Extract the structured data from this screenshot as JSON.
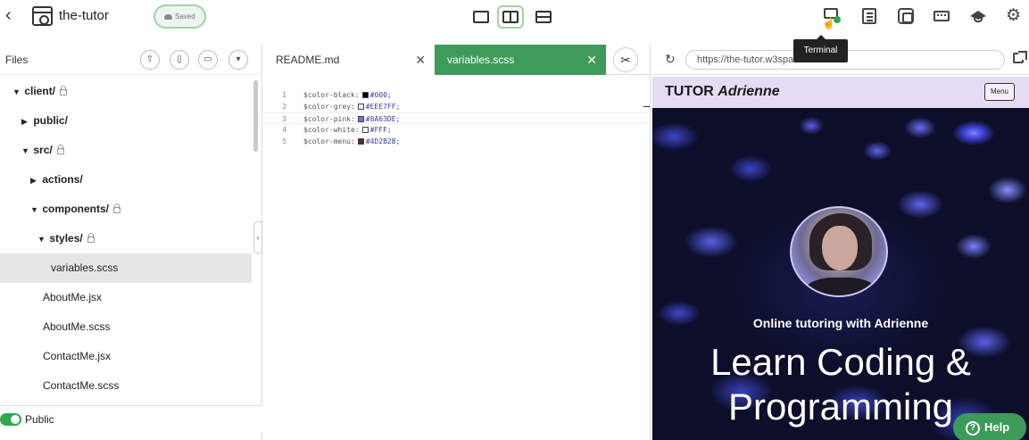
{
  "header": {
    "project_title": "the-tutor",
    "saved_label": "Saved",
    "terminal_tooltip": "Terminal"
  },
  "files": {
    "label": "Files",
    "tree": [
      {
        "label": "client/",
        "type": "folder",
        "expanded": true,
        "locked": true,
        "depth": 0
      },
      {
        "label": "public/",
        "type": "folder",
        "expanded": false,
        "locked": false,
        "depth": 1
      },
      {
        "label": "src/",
        "type": "folder",
        "expanded": true,
        "locked": true,
        "depth": 1
      },
      {
        "label": "actions/",
        "type": "folder",
        "expanded": false,
        "locked": false,
        "depth": 2
      },
      {
        "label": "components/",
        "type": "folder",
        "expanded": true,
        "locked": true,
        "depth": 2
      },
      {
        "label": "styles/",
        "type": "folder",
        "expanded": true,
        "locked": true,
        "depth": 3
      },
      {
        "label": "variables.scss",
        "type": "file",
        "selected": true,
        "depth": 4
      },
      {
        "label": "AboutMe.jsx",
        "type": "file",
        "depth": 3
      },
      {
        "label": "AboutMe.scss",
        "type": "file",
        "depth": 3
      },
      {
        "label": "ContactMe.jsx",
        "type": "file",
        "depth": 3
      },
      {
        "label": "ContactMe.scss",
        "type": "file",
        "depth": 3
      }
    ],
    "public_label": "Public"
  },
  "editor": {
    "tabs": [
      {
        "label": "README.md",
        "active": false
      },
      {
        "label": "variables.scss",
        "active": true
      }
    ],
    "lines": [
      {
        "num": "1",
        "var": "$color-black:",
        "value": "#000;",
        "swatch": "#000000"
      },
      {
        "num": "2",
        "var": "$color-grey:",
        "value": "#EEE7FF;",
        "swatch": "#EEE7FF"
      },
      {
        "num": "3",
        "var": "$color-pink:",
        "value": "#8A63DE;",
        "swatch": "#8A63DE"
      },
      {
        "num": "4",
        "var": "$color-white:",
        "value": "#FFF;",
        "swatch": "#FFFFFF"
      },
      {
        "num": "5",
        "var": "$color-menu:",
        "value": "#4D2B2B;",
        "swatch": "#4D2B2B"
      }
    ]
  },
  "preview": {
    "url": "https://the-tutor.w3spaces.com",
    "brand_prefix": "TUTOR",
    "brand_name": "Adrienne",
    "menu_label": "Menu",
    "hero_subtitle": "Online tutoring with Adrienne",
    "hero_title_line1": "Learn Coding &",
    "hero_title_line2": "Programming"
  },
  "help_label": "Help",
  "colors": {
    "accent_green": "#3E9B5A",
    "nav_lavender": "#E5DCF3"
  }
}
